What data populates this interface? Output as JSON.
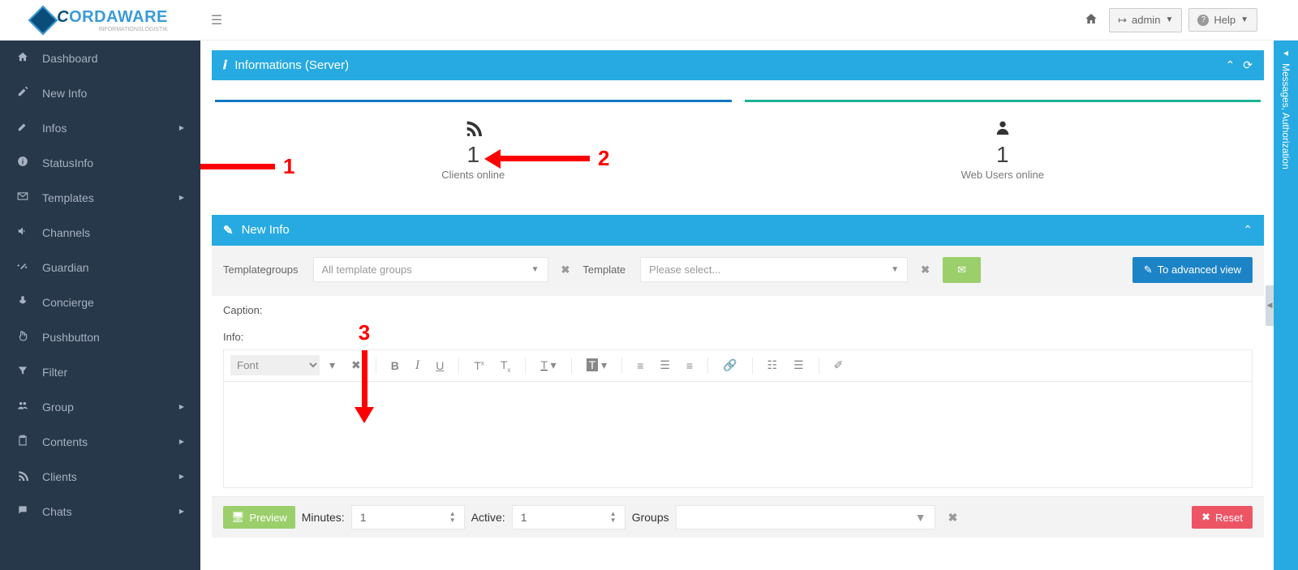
{
  "brand": {
    "name_c": "C",
    "name_rest": "ORDAWARE",
    "sub": "INFORMATIONSLOGISTIK"
  },
  "topbar": {
    "user_label": "admin",
    "help_label": "Help"
  },
  "sidebar": {
    "items": [
      {
        "label": "Dashboard",
        "icon": "home",
        "expand": false
      },
      {
        "label": "New Info",
        "icon": "edit",
        "expand": false
      },
      {
        "label": "Infos",
        "icon": "pencil",
        "expand": true
      },
      {
        "label": "StatusInfo",
        "icon": "info",
        "expand": false
      },
      {
        "label": "Templates",
        "icon": "mail",
        "expand": true
      },
      {
        "label": "Channels",
        "icon": "volume",
        "expand": false
      },
      {
        "label": "Guardian",
        "icon": "wand",
        "expand": false
      },
      {
        "label": "Concierge",
        "icon": "mic",
        "expand": false
      },
      {
        "label": "Pushbutton",
        "icon": "hand",
        "expand": false
      },
      {
        "label": "Filter",
        "icon": "filter",
        "expand": false
      },
      {
        "label": "Group",
        "icon": "users",
        "expand": true
      },
      {
        "label": "Contents",
        "icon": "clipboard",
        "expand": true
      },
      {
        "label": "Clients",
        "icon": "rss",
        "expand": true
      },
      {
        "label": "Chats",
        "icon": "chat",
        "expand": true
      }
    ]
  },
  "info_panel": {
    "title": "Informations (Server)",
    "clients_online_value": "1",
    "clients_online_label": "Clients online",
    "web_users_value": "1",
    "web_users_label": "Web Users online"
  },
  "newinfo_panel": {
    "title": "New Info",
    "templategroups_label": "Templategroups",
    "templategroups_value": "All template groups",
    "template_label": "Template",
    "template_placeholder": "Please select...",
    "advanced_label": "To advanced view",
    "caption_label": "Caption:",
    "info_label": "Info:",
    "font_placeholder": "Font",
    "preview_label": "Preview",
    "minutes_label": "Minutes:",
    "minutes_value": "1",
    "active_label": "Active:",
    "active_value": "1",
    "groups_label": "Groups",
    "reset_label": "Reset"
  },
  "rightbar": {
    "label": "Messages, Authorization"
  },
  "annotations": {
    "a1": "1",
    "a2": "2",
    "a3": "3"
  },
  "icons": {
    "home": "🏠",
    "edit": "📝",
    "pencil": "✎",
    "info": "ℹ",
    "mail": "✉",
    "volume": "🔊",
    "wand": "✨",
    "mic": "🎙",
    "hand": "☝",
    "filter": "▼",
    "users": "👥",
    "clipboard": "📋",
    "rss": "≋",
    "chat": "💬",
    "logout": "↪",
    "help": "?"
  }
}
